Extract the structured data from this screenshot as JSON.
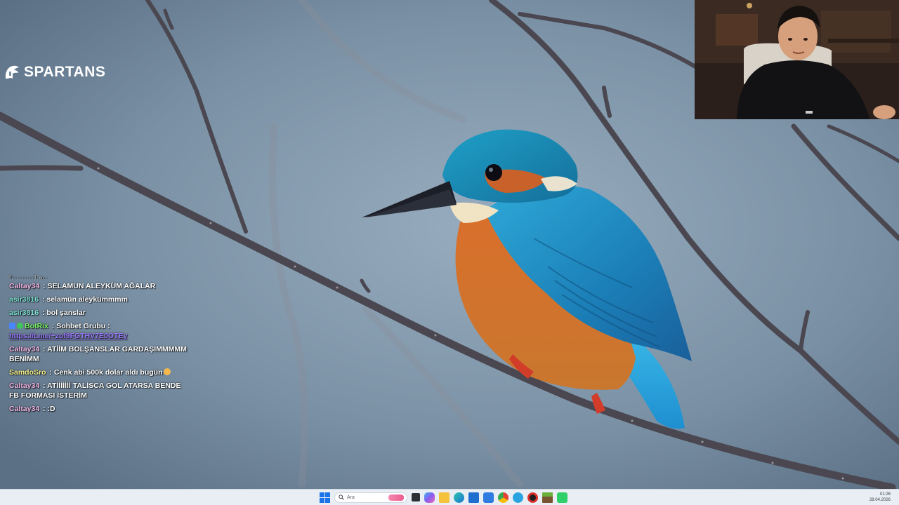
{
  "brand": {
    "logo_text": "SPARTANS"
  },
  "chat": {
    "cut_off_line": "[·········]·a··",
    "messages": [
      {
        "user": "Caltay34",
        "text": "SELAMUN ALEYKÜM AĞALAR"
      },
      {
        "user": "asir3816",
        "text": "selamün aleykümmmm"
      },
      {
        "user": "asir3816",
        "text": "bol şanslar"
      },
      {
        "user": "BotRix",
        "text": "Sohbet Grubu :",
        "link": "https://t.me/+zof9FGTHV7E0OTEy"
      },
      {
        "user": "Caltay34",
        "text": "ATİİM BOLŞANSLAR GARDAŞIMMMMM BENİMM"
      },
      {
        "user": "SamdoSro",
        "text": "Cenk abi 500k dolar aldı bugün"
      },
      {
        "user": "Caltay34",
        "text": "ATİİİİİİİ TALİSCA GOL ATARSA BENDE FB FORMASI İSTERİM"
      },
      {
        "user": "Caltay34",
        "text": ":D"
      }
    ],
    "colors": {
      "Caltay34": "#f1b6e6",
      "asir3816": "#7fe3d4",
      "BotRix": "#7cf56a",
      "SamdoSro": "#f6f08a",
      "link": "#9a79ff"
    }
  },
  "taskbar": {
    "search_placeholder": "Ara",
    "clock_time": "01:26",
    "clock_date": "28.04.2026",
    "pinned_icons": [
      "start-icon",
      "search-icon",
      "task-view-icon",
      "copilot-icon",
      "file-explorer-icon",
      "edge-icon",
      "microsoft-store-icon",
      "mail-icon",
      "chrome-icon",
      "telegram-icon",
      "app-red-icon",
      "minecraft-icon",
      "app-green-icon"
    ],
    "background_color": "#e9eef4"
  },
  "desktop": {
    "wallpaper": "kingfisher-on-branch"
  }
}
